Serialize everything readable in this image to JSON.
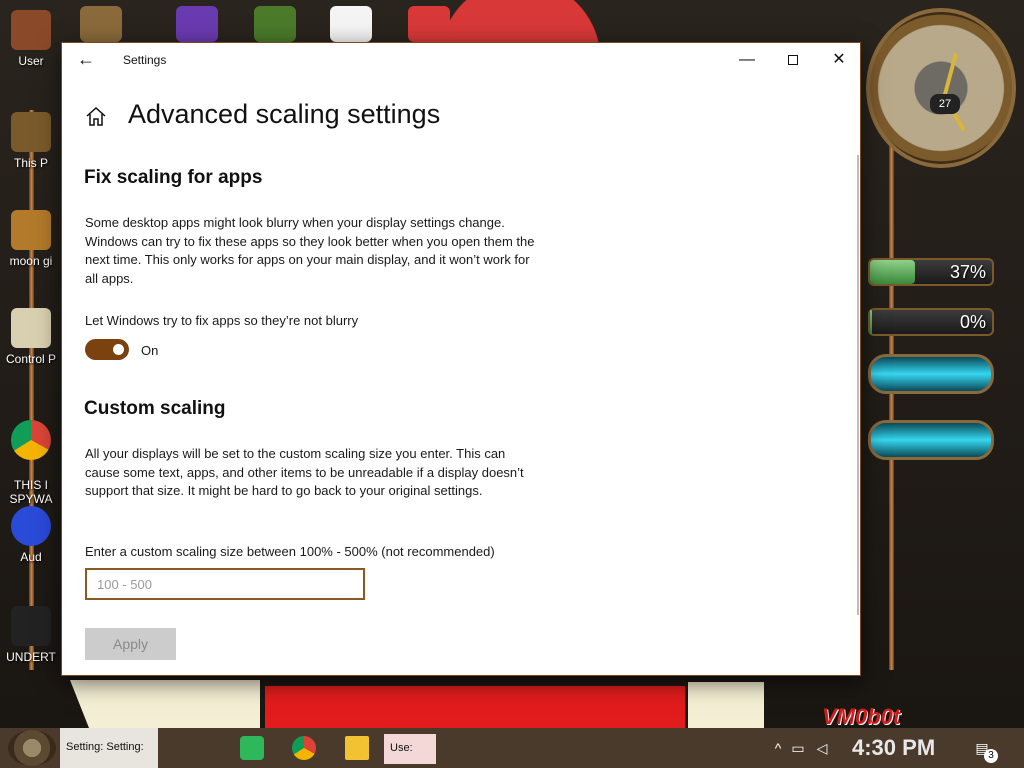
{
  "desktop": {
    "icons": [
      {
        "label": "User"
      },
      {
        "label": "This P"
      },
      {
        "label": "moon gi"
      },
      {
        "label": "Control P"
      },
      {
        "label": "THIS I\nSPYWA"
      },
      {
        "label": "Aud"
      },
      {
        "label": "UNDERT"
      }
    ],
    "widgets": {
      "clock_day": "27",
      "cpu_gauge": {
        "value_text": "37%",
        "percent": 37
      },
      "ram_gauge": {
        "value_text": "0%",
        "percent": 0
      }
    },
    "brand_tag": "VM0b0t",
    "colors": {
      "accent": "#7b4210",
      "window_border": "#7a4a1e"
    }
  },
  "window": {
    "title": "Settings",
    "back_icon": "arrow-left-icon",
    "controls": {
      "minimize": "—",
      "maximize": "maximize-icon",
      "close": "✕"
    }
  },
  "page": {
    "title": "Advanced scaling settings",
    "fix_scaling": {
      "heading": "Fix scaling for apps",
      "description": "Some desktop apps might look blurry when your display settings change. Windows can try to fix these apps so they look better when you open them the next time. This only works for apps on your main display, and it won’t work for all apps.",
      "toggle_label": "Let Windows try to fix apps so they’re not blurry",
      "toggle_state": "On"
    },
    "custom_scaling": {
      "heading": "Custom scaling",
      "description": "All your displays will be set to the custom scaling size you enter. This can cause some text, apps, and other items to be unreadable if a display doesn’t support that size. It might be hard to go back to your original settings.",
      "input_label": "Enter a custom scaling size between 100% - 500% (not recommended)",
      "input_placeholder": "100 - 500",
      "input_value": "",
      "apply_label": "Apply"
    }
  },
  "taskbar": {
    "settings_item": "Setting: Setting:",
    "user_item": "Use:",
    "time": "4:30 PM",
    "notification_count": "3"
  }
}
